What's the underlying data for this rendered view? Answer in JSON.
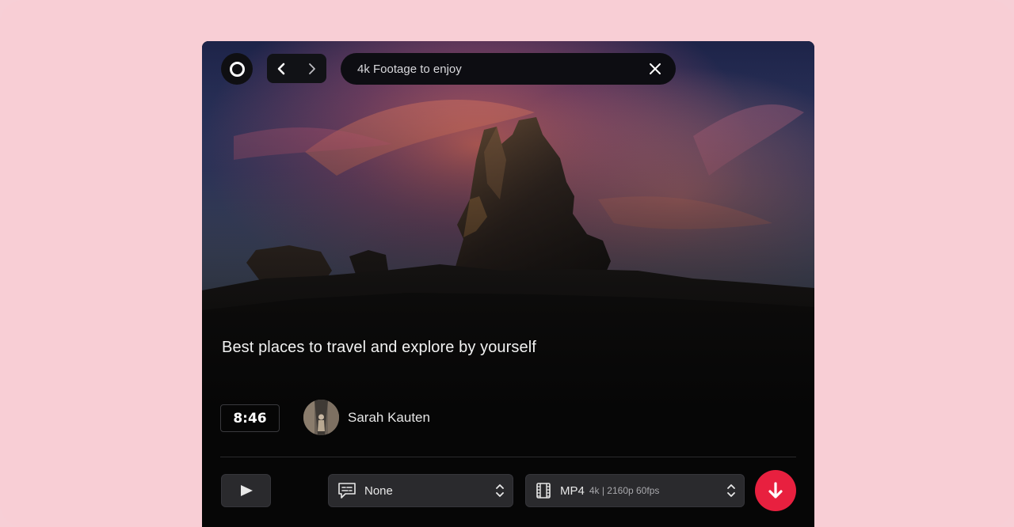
{
  "search": {
    "query": "4k Footage to enjoy"
  },
  "video": {
    "title": "Best places to travel and explore by yourself",
    "duration": "8:46",
    "author": "Sarah Kauten"
  },
  "controls": {
    "subtitles_value": "None",
    "format_value": "MP4",
    "format_detail": "4k | 2160p 60fps"
  },
  "icons": {
    "home": "ring-icon",
    "back": "chevron-left-icon",
    "forward": "chevron-right-icon",
    "clear": "close-icon",
    "play": "play-icon",
    "subtitles": "subtitles-icon",
    "format": "film-icon",
    "sort": "chevron-up-down-icon",
    "download": "arrow-down-icon"
  },
  "colors": {
    "page_bg": "#f8ced5",
    "panel_bg": "#060606",
    "accent": "#e8203f"
  }
}
